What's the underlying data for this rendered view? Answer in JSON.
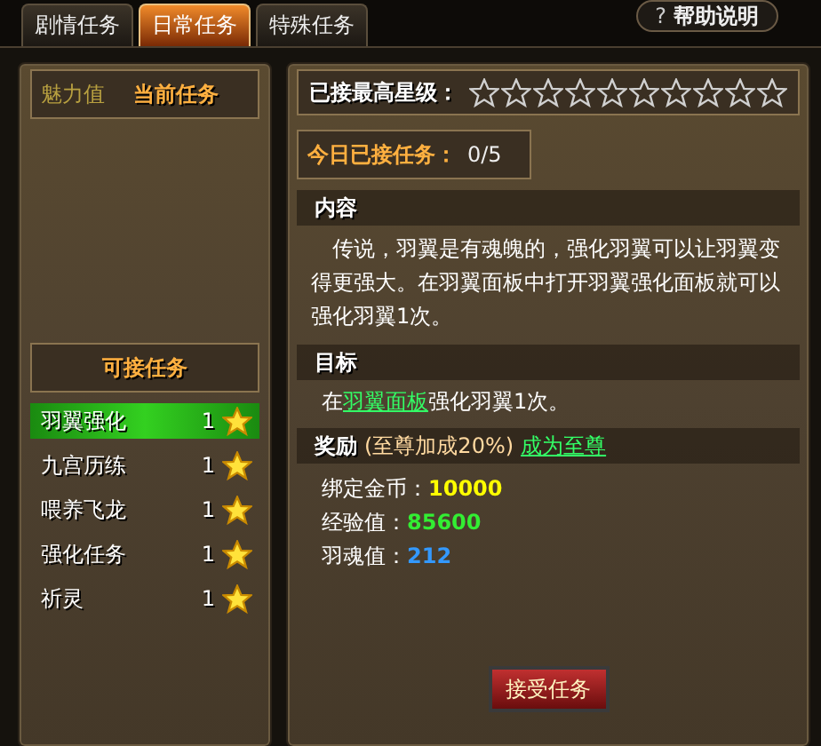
{
  "tabs": [
    {
      "label": "剧情任务",
      "selected": false
    },
    {
      "label": "日常任务",
      "selected": true
    },
    {
      "label": "特殊任务",
      "selected": false
    }
  ],
  "help_button": {
    "icon_text": "?",
    "label": "帮助说明"
  },
  "current_tasks": {
    "overlay_text": "魅力值",
    "title": "当前任务"
  },
  "available_tasks": {
    "title": "可接任务",
    "items": [
      {
        "name": "羽翼强化",
        "count": "1",
        "selected": true
      },
      {
        "name": "九宫历练",
        "count": "1",
        "selected": false
      },
      {
        "name": "喂养飞龙",
        "count": "1",
        "selected": false
      },
      {
        "name": "强化任务",
        "count": "1",
        "selected": false
      },
      {
        "name": "祈灵",
        "count": "1",
        "selected": false
      }
    ]
  },
  "max_star": {
    "label": "已接最高星级：",
    "stars": 0
  },
  "today": {
    "label": "今日已接任务：",
    "value": "0/5"
  },
  "content": {
    "title": "内容",
    "text": "传说，羽翼是有魂魄的，强化羽翼可以让羽翼变得更强大。在羽翼面板中打开羽翼强化面板就可以强化羽翼1次。"
  },
  "goal": {
    "title": "目标",
    "before": "在",
    "link": "羽翼面板",
    "after": "强化羽翼1次。"
  },
  "reward": {
    "title": "奖励",
    "bonus": "(至尊加成20%)",
    "link": "成为至尊",
    "items": [
      {
        "label": "绑定金币：",
        "value": "10000",
        "color": "#ffff00"
      },
      {
        "label": "经验值：",
        "value": "85600",
        "color": "#33ee33"
      },
      {
        "label": "羽魂值：",
        "value": "212",
        "color": "#3399ff"
      }
    ]
  },
  "accept_button": "接受任务"
}
